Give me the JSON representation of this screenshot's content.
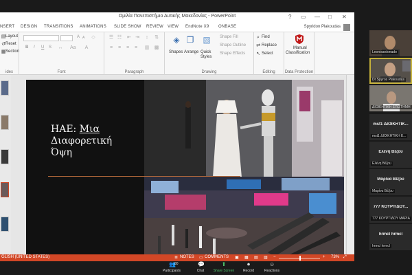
{
  "colors": {
    "ppt_accent": "#d24726",
    "active_speaker": "#c6b23a",
    "share_green": "#4ec26a"
  },
  "ppt": {
    "window_title": "Ομιλία Πανεπιστήμιο Δυτικής Μακεδονίας - PowerPoint",
    "window_controls": [
      "?",
      "▭",
      "—",
      "□",
      "✕"
    ],
    "menu_tabs": [
      "NSERT",
      "DESIGN",
      "TRANSITIONS",
      "ANIMATIONS",
      "SLIDE SHOW",
      "REVIEW",
      "VIEW",
      "EndNote X9",
      "ONBASE"
    ],
    "user_name": "Spyridon Plakoudas",
    "ribbon": {
      "slides": {
        "layout": "Layout",
        "reset": "Reset",
        "section": "Section",
        "label": "ides"
      },
      "font": {
        "label": "Font",
        "bold": "B",
        "italic": "I",
        "underline": "U",
        "strike": "S",
        "grow": "A",
        "shrink": "A"
      },
      "paragraph": {
        "label": "Paragraph"
      },
      "drawing": {
        "shapes": "Shapes",
        "arrange": "Arrange",
        "quick_styles": "Quick Styles",
        "shape_fill": "Shape Fill",
        "shape_outline": "Shape Outline",
        "shape_effects": "Shape Effects",
        "label": "Drawing"
      },
      "editing": {
        "find": "Find",
        "replace": "Replace",
        "select": "Select",
        "label": "Editing"
      },
      "data_protection": {
        "manual": "Manual",
        "classification": "Classification",
        "label": "Data Protection"
      }
    },
    "slide": {
      "title_line1_a": "ΗΑΕ: ",
      "title_line1_b": "Μια",
      "title_line2": "Διαφορετική",
      "title_line3": "Όψη"
    },
    "status": {
      "language": "GLISH (UNITED STATES)",
      "notes": "NOTES",
      "comments": "COMMENTS",
      "zoom": "73%"
    }
  },
  "participants": [
    {
      "name": "",
      "subtitle": "Leonisardonado",
      "kind": "video",
      "active": false
    },
    {
      "name": "",
      "subtitle": "Dr Spyros Plakoudas",
      "kind": "video",
      "active": true
    },
    {
      "name": "",
      "subtitle": "ΔΙΟΙΚΗΤΙΚΗ ΕΠΙΣΤΗΜΗ",
      "kind": "video",
      "active": false
    },
    {
      "name": "mst1 ΔΙΟΙΚΗΤΙΚ...",
      "subtitle": "mst1 ΔΙΟΙΚΗΤΙΚΗ Ε...",
      "kind": "name",
      "active": false
    },
    {
      "name": "Ελένη Βέζου",
      "subtitle": "Ελένη Βέζου",
      "kind": "name",
      "active": false
    },
    {
      "name": "Μαρίνα Βέζου",
      "subtitle": "Μαρίνα Βέζου",
      "kind": "name",
      "active": false
    },
    {
      "name": "777 ΚΟΥΡΤΙΔΟΥ...",
      "subtitle": "777 ΚΟΥΡΤΙΔΟΥ ΜΑΡΙΑ",
      "kind": "name",
      "active": false
    },
    {
      "name": "hrmcl hrmcl",
      "subtitle": "hrmcl hrmcl",
      "kind": "name",
      "active": false
    }
  ],
  "zoom_toolbar": {
    "participants": "Participants",
    "participants_count": "80",
    "chat": "Chat",
    "share_screen": "Share Screen",
    "record": "Record",
    "reactions": "Reactions"
  }
}
